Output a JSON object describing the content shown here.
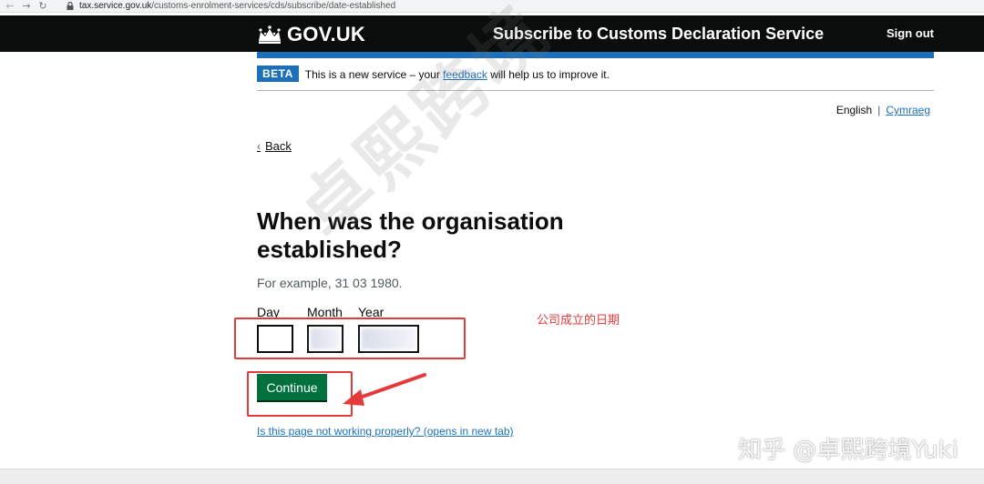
{
  "browser": {
    "back_icon": "←",
    "forward_icon": "→",
    "reload_icon": "↻",
    "url_host": "tax.service.gov.uk",
    "url_path": "/customs-enrolment-services/cds/subscribe/date-established"
  },
  "header": {
    "logo_text": "GOV.UK",
    "service_name": "Subscribe to Customs Declaration Service",
    "sign_out": "Sign out"
  },
  "beta": {
    "tag": "BETA",
    "text_before": "This is a new service – your ",
    "feedback_link": "feedback",
    "text_after": " will help us to improve it."
  },
  "language": {
    "current": "English",
    "separator": "|",
    "other": "Cymraeg"
  },
  "back_link": {
    "chevron": "‹",
    "label": "Back"
  },
  "page": {
    "heading": "When was the organisation established?",
    "hint": "For example, 31 03 1980."
  },
  "date": {
    "day_label": "Day",
    "month_label": "Month",
    "year_label": "Year"
  },
  "annotation": {
    "note": "公司成立的日期"
  },
  "continue_label": "Continue",
  "report_link": "Is this page not working properly? (opens in new tab)",
  "watermarks": {
    "center": "卓熙跨境",
    "corner": "知乎 @卓熙跨境Yuki"
  },
  "colors": {
    "header_bg": "#0b0c0c",
    "govuk_blue": "#1d70b8",
    "button_green": "#00703c",
    "annotation_red": "#e5393b"
  }
}
